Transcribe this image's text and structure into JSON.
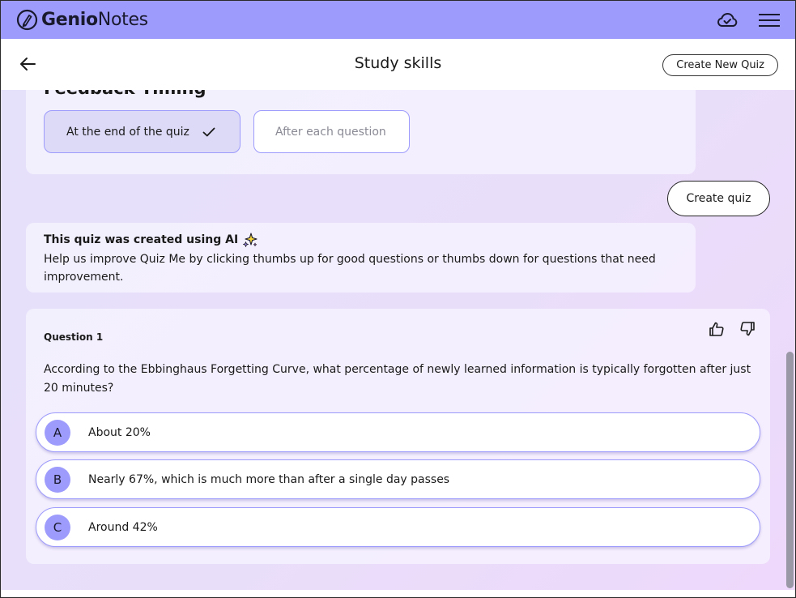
{
  "app": {
    "logo_word1": "Genio",
    "logo_word2": "Notes"
  },
  "header": {
    "title": "Study skills",
    "create_new_quiz_label": "Create New Quiz"
  },
  "feedback_timing": {
    "title": "Feedback Timing",
    "options": [
      {
        "label": "At the end of the quiz",
        "selected": true
      },
      {
        "label": "After each question",
        "selected": false
      }
    ]
  },
  "create_quiz_label": "Create quiz",
  "ai_notice": {
    "title": "This quiz was created using AI",
    "text": "Help us improve Quiz Me by clicking thumbs up for good questions or thumbs down for questions that need improvement."
  },
  "question": {
    "label": "Question 1",
    "text": "According to the Ebbinghaus Forgetting Curve, what percentage of newly learned information is typically forgotten after just 20 minutes?",
    "answers": [
      {
        "letter": "A",
        "text": "About 20%"
      },
      {
        "letter": "B",
        "text": "Nearly 67%, which is much more than after a single day passes"
      },
      {
        "letter": "C",
        "text": "Around 42%"
      }
    ]
  },
  "colors": {
    "brand": "#9d9bfb",
    "selected_option_bg": "#dcdaf7"
  }
}
